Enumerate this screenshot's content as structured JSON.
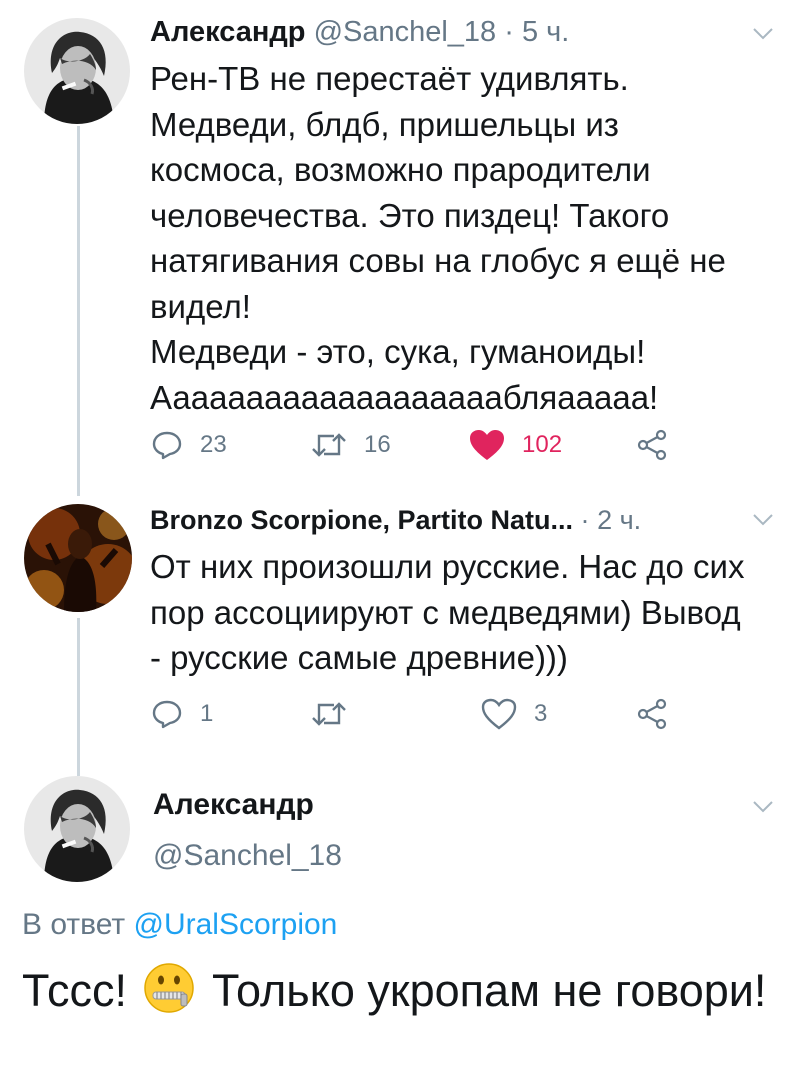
{
  "thread": [
    {
      "author": "Александр",
      "handle": "@Sanchel_18",
      "separator": "·",
      "time": "5 ч.",
      "text": "Рен-ТВ не перестаёт удивлять.\nМедведи, блдб, пришельцы из\nкосмоса, возможно прародители\nчеловечества. Это пиздец! Такого\nнатягивания совы на глобус я ещё не\nвидел!\nМедведи - это, сука, гуманоиды!\nАаааааааааааааааааабляааааа!",
      "replies": "23",
      "retweets": "16",
      "likes": "102",
      "liked": true
    },
    {
      "author": "Bronzo Scorpione, Partito Natu...",
      "handle": "",
      "separator": "·",
      "time": "2 ч.",
      "text": "От них произошли русские. Нас до сих\nпор ассоциируют с медведями) Вывод\n- русские самые древние)))",
      "replies": "1",
      "retweets": "",
      "likes": "3",
      "liked": false
    }
  ],
  "focused_tweet": {
    "author": "Александр",
    "handle": "@Sanchel_18",
    "reply_prefix": "В ответ",
    "reply_mention": "@UralScorpion",
    "text_part1": "Тссс!",
    "emoji": "zipper-mouth-face",
    "text_part2": "Только укропам не говори!"
  },
  "colors": {
    "text": "#14171a",
    "secondary": "#657786",
    "link": "#1da1f2",
    "like": "#e0245e",
    "thread_line": "#ccd6dd"
  }
}
